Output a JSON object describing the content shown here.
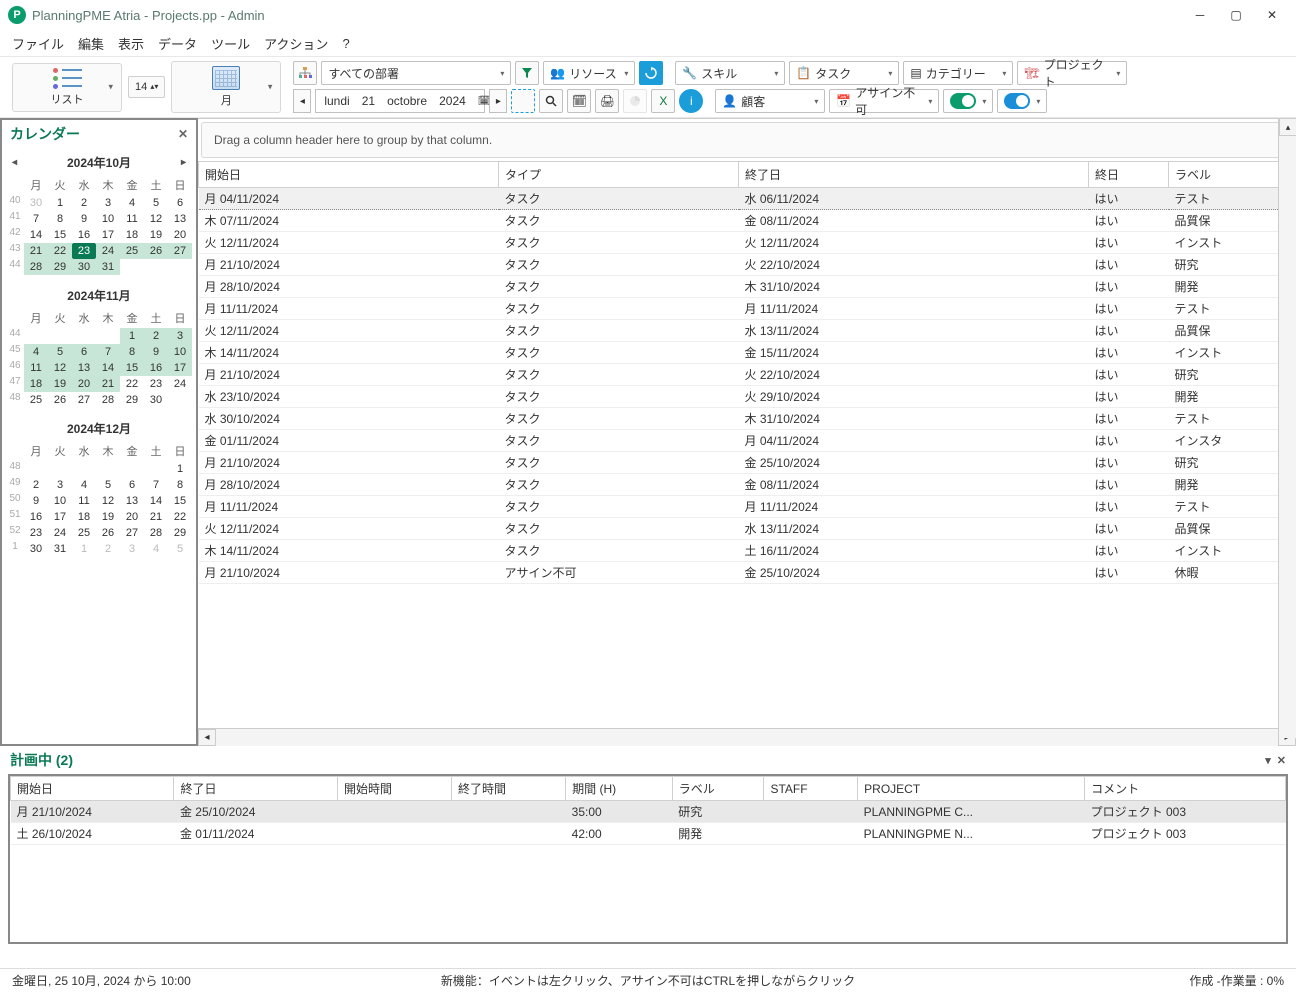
{
  "window": {
    "title": "PlanningPME Atria - Projects.pp - Admin"
  },
  "menu": [
    "ファイル",
    "編集",
    "表示",
    "データ",
    "ツール",
    "アクション",
    "?"
  ],
  "toolbar": {
    "list_label": "リスト",
    "month_label": "月",
    "font_size": "14",
    "dept_combo": "すべての部署",
    "date_nav": {
      "day": "lundi",
      "dnum": "21",
      "month": "octobre",
      "year": "2024"
    },
    "combos": {
      "resource": "リソース",
      "skill": "スキル",
      "task": "タスク",
      "category": "カテゴリー",
      "project": "プロジェクト",
      "customer": "顧客",
      "unassign": "アサイン不可"
    }
  },
  "sidebar": {
    "title": "カレンダー",
    "months": [
      {
        "title": "2024年10月",
        "show_nav": true,
        "dow": [
          "月",
          "火",
          "水",
          "木",
          "金",
          "土",
          "日"
        ],
        "weeks": [
          {
            "wk": "40",
            "days": [
              {
                "n": "30",
                "o": 1
              },
              {
                "n": "1"
              },
              {
                "n": "2"
              },
              {
                "n": "3"
              },
              {
                "n": "4"
              },
              {
                "n": "5"
              },
              {
                "n": "6"
              }
            ]
          },
          {
            "wk": "41",
            "days": [
              {
                "n": "7"
              },
              {
                "n": "8"
              },
              {
                "n": "9"
              },
              {
                "n": "10"
              },
              {
                "n": "11"
              },
              {
                "n": "12"
              },
              {
                "n": "13"
              }
            ]
          },
          {
            "wk": "42",
            "days": [
              {
                "n": "14"
              },
              {
                "n": "15"
              },
              {
                "n": "16"
              },
              {
                "n": "17"
              },
              {
                "n": "18"
              },
              {
                "n": "19"
              },
              {
                "n": "20"
              }
            ]
          },
          {
            "wk": "43",
            "days": [
              {
                "n": "21",
                "h": 1
              },
              {
                "n": "22",
                "h": 1
              },
              {
                "n": "23",
                "t": 1
              },
              {
                "n": "24",
                "h": 1
              },
              {
                "n": "25",
                "h": 1
              },
              {
                "n": "26",
                "h": 1
              },
              {
                "n": "27",
                "h": 1
              }
            ]
          },
          {
            "wk": "44",
            "days": [
              {
                "n": "28",
                "h": 1
              },
              {
                "n": "29",
                "h": 1
              },
              {
                "n": "30",
                "h": 1
              },
              {
                "n": "31",
                "h": 1
              },
              {
                "n": ""
              },
              {
                "n": ""
              },
              {
                "n": ""
              }
            ]
          }
        ]
      },
      {
        "title": "2024年11月",
        "show_nav": false,
        "dow": [
          "月",
          "火",
          "水",
          "木",
          "金",
          "土",
          "日"
        ],
        "weeks": [
          {
            "wk": "44",
            "days": [
              {
                "n": ""
              },
              {
                "n": ""
              },
              {
                "n": ""
              },
              {
                "n": ""
              },
              {
                "n": "1",
                "h": 1
              },
              {
                "n": "2",
                "h": 1
              },
              {
                "n": "3",
                "h": 1
              }
            ]
          },
          {
            "wk": "45",
            "days": [
              {
                "n": "4",
                "h": 1
              },
              {
                "n": "5",
                "h": 1
              },
              {
                "n": "6",
                "h": 1
              },
              {
                "n": "7",
                "h": 1
              },
              {
                "n": "8",
                "h": 1
              },
              {
                "n": "9",
                "h": 1
              },
              {
                "n": "10",
                "h": 1
              }
            ]
          },
          {
            "wk": "46",
            "days": [
              {
                "n": "11",
                "h": 1
              },
              {
                "n": "12",
                "h": 1
              },
              {
                "n": "13",
                "h": 1
              },
              {
                "n": "14",
                "h": 1
              },
              {
                "n": "15",
                "h": 1
              },
              {
                "n": "16",
                "h": 1
              },
              {
                "n": "17",
                "h": 1
              }
            ]
          },
          {
            "wk": "47",
            "days": [
              {
                "n": "18",
                "h": 1
              },
              {
                "n": "19",
                "h": 1
              },
              {
                "n": "20",
                "h": 1
              },
              {
                "n": "21",
                "h": 1
              },
              {
                "n": "22"
              },
              {
                "n": "23"
              },
              {
                "n": "24"
              }
            ]
          },
          {
            "wk": "48",
            "days": [
              {
                "n": "25"
              },
              {
                "n": "26"
              },
              {
                "n": "27"
              },
              {
                "n": "28"
              },
              {
                "n": "29"
              },
              {
                "n": "30"
              },
              {
                "n": ""
              }
            ]
          }
        ]
      },
      {
        "title": "2024年12月",
        "show_nav": false,
        "dow": [
          "月",
          "火",
          "水",
          "木",
          "金",
          "土",
          "日"
        ],
        "weeks": [
          {
            "wk": "48",
            "days": [
              {
                "n": ""
              },
              {
                "n": ""
              },
              {
                "n": ""
              },
              {
                "n": ""
              },
              {
                "n": ""
              },
              {
                "n": ""
              },
              {
                "n": "1"
              }
            ]
          },
          {
            "wk": "49",
            "days": [
              {
                "n": "2"
              },
              {
                "n": "3"
              },
              {
                "n": "4"
              },
              {
                "n": "5"
              },
              {
                "n": "6"
              },
              {
                "n": "7"
              },
              {
                "n": "8"
              }
            ]
          },
          {
            "wk": "50",
            "days": [
              {
                "n": "9"
              },
              {
                "n": "10"
              },
              {
                "n": "11"
              },
              {
                "n": "12"
              },
              {
                "n": "13"
              },
              {
                "n": "14"
              },
              {
                "n": "15"
              }
            ]
          },
          {
            "wk": "51",
            "days": [
              {
                "n": "16"
              },
              {
                "n": "17"
              },
              {
                "n": "18"
              },
              {
                "n": "19"
              },
              {
                "n": "20"
              },
              {
                "n": "21"
              },
              {
                "n": "22"
              }
            ]
          },
          {
            "wk": "52",
            "days": [
              {
                "n": "23"
              },
              {
                "n": "24"
              },
              {
                "n": "25"
              },
              {
                "n": "26"
              },
              {
                "n": "27"
              },
              {
                "n": "28"
              },
              {
                "n": "29"
              }
            ]
          },
          {
            "wk": "1",
            "days": [
              {
                "n": "30"
              },
              {
                "n": "31"
              },
              {
                "n": "1",
                "o": 1
              },
              {
                "n": "2",
                "o": 1
              },
              {
                "n": "3",
                "o": 1
              },
              {
                "n": "4",
                "o": 1
              },
              {
                "n": "5",
                "o": 1
              }
            ]
          }
        ]
      }
    ]
  },
  "grid": {
    "group_hint": "Drag a column header here to group by that column.",
    "columns": [
      "開始日",
      "タイプ",
      "終了日",
      "終日",
      "ラベル"
    ],
    "rows": [
      {
        "sel": 1,
        "c": [
          "月 04/11/2024",
          "タスク",
          "水 06/11/2024",
          "はい",
          "テスト"
        ]
      },
      {
        "c": [
          "木 07/11/2024",
          "タスク",
          "金 08/11/2024",
          "はい",
          "品質保"
        ]
      },
      {
        "c": [
          "火 12/11/2024",
          "タスク",
          "火 12/11/2024",
          "はい",
          "インスト"
        ]
      },
      {
        "c": [
          "月 21/10/2024",
          "タスク",
          "火 22/10/2024",
          "はい",
          "研究"
        ]
      },
      {
        "c": [
          "月 28/10/2024",
          "タスク",
          "木 31/10/2024",
          "はい",
          "開発"
        ]
      },
      {
        "c": [
          "月 11/11/2024",
          "タスク",
          "月 11/11/2024",
          "はい",
          "テスト"
        ]
      },
      {
        "c": [
          "火 12/11/2024",
          "タスク",
          "水 13/11/2024",
          "はい",
          "品質保"
        ]
      },
      {
        "c": [
          "木 14/11/2024",
          "タスク",
          "金 15/11/2024",
          "はい",
          "インスト"
        ]
      },
      {
        "c": [
          "月 21/10/2024",
          "タスク",
          "火 22/10/2024",
          "はい",
          "研究"
        ]
      },
      {
        "c": [
          "水 23/10/2024",
          "タスク",
          "火 29/10/2024",
          "はい",
          "開発"
        ]
      },
      {
        "c": [
          "水 30/10/2024",
          "タスク",
          "木 31/10/2024",
          "はい",
          "テスト"
        ]
      },
      {
        "c": [
          "金 01/11/2024",
          "タスク",
          "月 04/11/2024",
          "はい",
          "インスタ"
        ]
      },
      {
        "c": [
          "月 21/10/2024",
          "タスク",
          "金 25/10/2024",
          "はい",
          "研究"
        ]
      },
      {
        "c": [
          "月 28/10/2024",
          "タスク",
          "金 08/11/2024",
          "はい",
          "開発"
        ]
      },
      {
        "c": [
          "月 11/11/2024",
          "タスク",
          "月 11/11/2024",
          "はい",
          "テスト"
        ]
      },
      {
        "c": [
          "火 12/11/2024",
          "タスク",
          "水 13/11/2024",
          "はい",
          "品質保"
        ]
      },
      {
        "c": [
          "木 14/11/2024",
          "タスク",
          "土 16/11/2024",
          "はい",
          "インスト"
        ]
      },
      {
        "c": [
          "月 21/10/2024",
          "アサイン不可",
          "金 25/10/2024",
          "はい",
          "休暇"
        ]
      }
    ]
  },
  "bottom": {
    "title": "計画中 (2)",
    "columns": [
      "開始日",
      "終了日",
      "開始時間",
      "終了時間",
      "期間 (H)",
      "ラベル",
      "STAFF",
      "PROJECT",
      "コメント"
    ],
    "rows": [
      {
        "sel": 1,
        "c": [
          "月 21/10/2024",
          "金 25/10/2024",
          "",
          "",
          "35:00",
          "研究",
          "",
          "PLANNINGPME C...",
          "プロジェクト 003"
        ]
      },
      {
        "c": [
          "土 26/10/2024",
          "金 01/11/2024",
          "",
          "",
          "42:00",
          "開発",
          "",
          "PLANNINGPME N...",
          "プロジェクト 003"
        ]
      }
    ]
  },
  "status": {
    "left": "金曜日, 25 10月, 2024 から 10:00",
    "mid": "新機能：イベントは左クリック、アサイン不可はCTRLを押しながらクリック",
    "right": "作成 -作業量 : 0%"
  }
}
